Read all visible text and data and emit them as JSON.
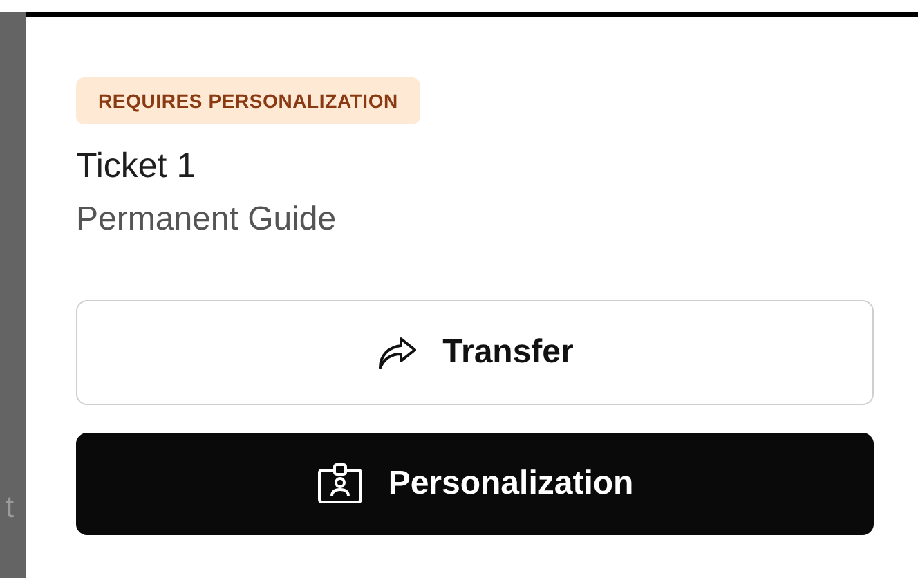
{
  "backdrop_text": "t",
  "badge": "REQUIRES PERSONALIZATION",
  "ticket": {
    "title": "Ticket 1",
    "subtitle": "Permanent Guide"
  },
  "buttons": [
    {
      "kind": "outline",
      "label": "Transfer"
    },
    {
      "kind": "solid",
      "label": "Personalization"
    }
  ]
}
